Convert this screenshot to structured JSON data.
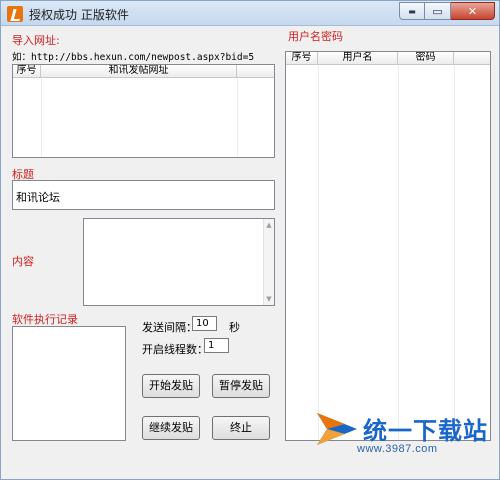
{
  "window": {
    "title": "授权成功 正版软件",
    "min_glyph": "▬",
    "max_glyph": "▭",
    "close_glyph": "✕"
  },
  "import": {
    "label": "导入网址:",
    "example": "如：http://bbs.hexun.com/newpost.aspx?bid=5",
    "columns": [
      "序号",
      "和讯发帖网址"
    ]
  },
  "title_field": {
    "label": "标题",
    "value": "和讯论坛"
  },
  "content_field": {
    "label": "内容",
    "value": ""
  },
  "log": {
    "label": "软件执行记录"
  },
  "accounts": {
    "label": "用户名密码",
    "columns": [
      "序号",
      "用户名",
      "密码"
    ]
  },
  "settings": {
    "interval_label": "发送间隔：",
    "interval_value": "10",
    "interval_unit": "秒",
    "threads_label": "开启线程数：",
    "threads_value": "1"
  },
  "buttons": {
    "start": "开始发贴",
    "pause": "暂停发贴",
    "resume": "继续发贴",
    "stop": "终止"
  },
  "watermark": {
    "brand": "统一下载站",
    "url": "www.3987.com"
  },
  "icons": {
    "app": "app-icon",
    "scroll_up": "▲",
    "scroll_down": "▼"
  },
  "colors": {
    "label_red": "#d11f1f",
    "watermark_blue": "#1a66c8",
    "logo_orange": "#e8740c"
  }
}
